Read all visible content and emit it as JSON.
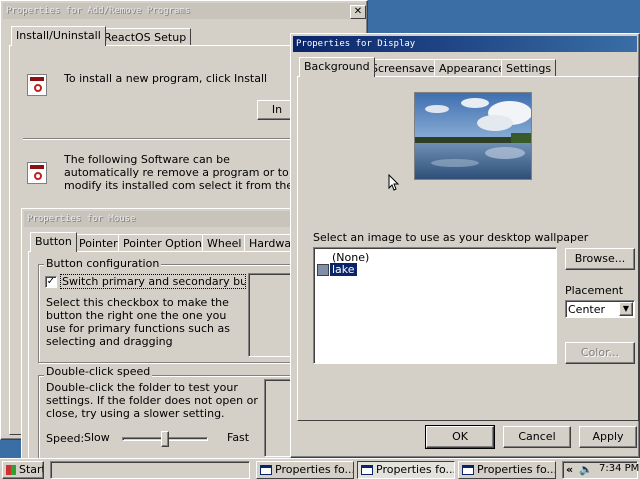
{
  "add_remove": {
    "title": "Properties for Add/Remove Programs",
    "tabs": [
      "Install/Uninstall",
      "ReactOS Setup"
    ],
    "install_text": "To install a new program, click Install",
    "install_button": "In",
    "remove_text": "The following Software can be automatically re remove a program or to modify its installed com select it from the list and click Add/Remove."
  },
  "mouse": {
    "title": "Properties for Mouse",
    "tabs": [
      "Button",
      "Pointer",
      "Pointer Options",
      "Wheel",
      "Hardwar"
    ],
    "button_config_legend": "Button configuration",
    "switch_label": "Switch primary and secondary buttons",
    "switch_description": "Select this checkbox to make the button the right one the one you use for primary functions such as selecting and dragging",
    "dblclick_legend": "Double-click speed",
    "dblclick_description": "Double-click the folder to test your settings. If the folder does not open or close, try using a slower setting.",
    "speed_label": "Speed:",
    "slow_label": "Slow",
    "fast_label": "Fast",
    "speed_level": 0.5
  },
  "display": {
    "title": "Properties for Display",
    "tabs": [
      "Background",
      "Screensaver",
      "Appearance",
      "Settings"
    ],
    "wallpaper_prompt": "Select an image to use as your desktop wallpaper",
    "wallpapers": [
      "(None)",
      "lake"
    ],
    "selected_wallpaper": "lake",
    "browse_button": "Browse...",
    "placement_label": "Placement",
    "placement_value": "Center",
    "color_button": "Color...",
    "ok_button": "OK",
    "cancel_button": "Cancel",
    "apply_button": "Apply"
  },
  "taskbar": {
    "start_label": "Start",
    "tasks": [
      "Properties fo...",
      "Properties fo...",
      "Properties fo..."
    ],
    "clock": "7:34 PM"
  },
  "colors": {
    "desktop": "#3a6ea5",
    "selection": "#0a246a",
    "face": "#d4d0c8"
  }
}
